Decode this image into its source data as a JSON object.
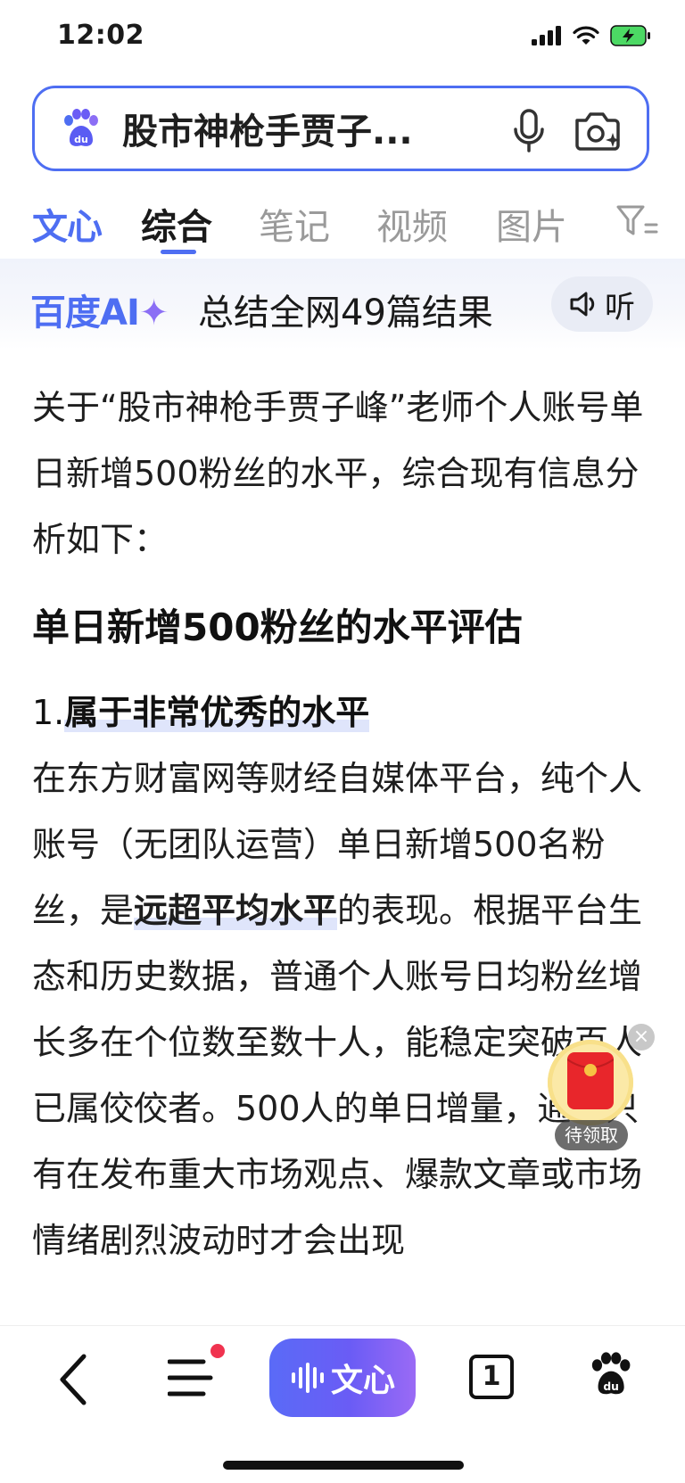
{
  "status_bar": {
    "time": "12:02"
  },
  "search": {
    "query": "股市神枪手贾子..."
  },
  "tabs": [
    {
      "label": "文心"
    },
    {
      "label": "综合"
    },
    {
      "label": "笔记"
    },
    {
      "label": "视频"
    },
    {
      "label": "图片"
    }
  ],
  "ai_banner": {
    "logo": "百度AI",
    "logo_star": "✦",
    "summary": "总结全网49篇结果",
    "listen_label": "听"
  },
  "content": {
    "intro": "关于“股市神枪手贾子峰”老师个人账号单日新增500粉丝的水平，综合现有信息分析如下：",
    "heading": "单日新增500粉丝的水平评估",
    "list_number": "1.",
    "list_title": "属于非常优秀的水平",
    "body_part1": "在东方财富网等财经自媒体平台，纯个人账号（无团队运营）单日新增500名粉丝，是",
    "body_highlight": "远超平均水平",
    "body_part2": "的表现。根据平台生态和历史数据，普通个人账号日均粉丝增长多在个位数至数十人，能稳定突破百人已属佼佼者。500人的单日增量，通常只有在发布重大市场观点、爆款文章或市场情绪剧烈波动时才会出现"
  },
  "floating": {
    "redpack_label": "待领取",
    "close": "×"
  },
  "bottom_nav": {
    "wenxin_label": "文心",
    "tab_count": "1"
  },
  "colors": {
    "accent": "#4e6ef2",
    "badge": "#f0334f",
    "redpack": "#e8262b"
  }
}
